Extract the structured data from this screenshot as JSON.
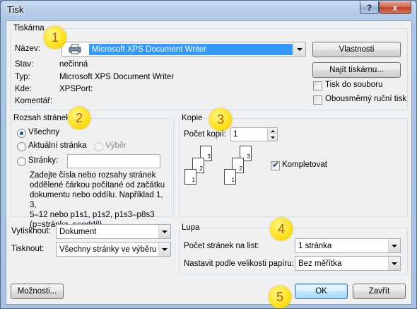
{
  "window": {
    "title": "Tisk",
    "help_label": "?",
    "close_label": "x"
  },
  "printer": {
    "group_title": "Tiskárna",
    "name_label": "Název:",
    "name_value": "Microsoft XPS Document Writer",
    "status_label": "Stav:",
    "status_value": "nečinná",
    "type_label": "Typ:",
    "type_value": "Microsoft XPS Document Writer",
    "where_label": "Kde:",
    "where_value": "XPSPort:",
    "comment_label": "Komentář:",
    "comment_value": "",
    "properties_button": "Vlastnosti",
    "find_printer_button": "Najít tiskárnu...",
    "print_to_file_label": "Tisk do souboru",
    "print_to_file_checked": false,
    "duplex_label": "Obousměrný ruční tisk",
    "duplex_checked": false
  },
  "page_range": {
    "group_title": "Rozsah stránek",
    "all_label": "Všechny",
    "current_label": "Aktuální stránka",
    "selection_label": "Výběr",
    "pages_label": "Stránky:",
    "pages_value": "",
    "selected": "all",
    "help_lines": [
      "Zadejte čísla nebo rozsahy stránek",
      "oddělené čárkou počítané od začátku",
      "dokumentu nebo oddílu. Například 1, 3,",
      "5–12 nebo p1s1, p1s2, p1s3–p8s3",
      "(p=stránka, s=oddíl)."
    ]
  },
  "copies": {
    "group_title": "Kopie",
    "count_label": "Počet kopií:",
    "count_value": "1",
    "collate_label": "Kompletovat",
    "collate_checked": true,
    "page_numbers": [
      "1",
      "2",
      "3"
    ]
  },
  "print_what": {
    "label": "Vytisknout:",
    "value": "Dokument"
  },
  "print": {
    "label": "Tisknout:",
    "value": "Všechny stránky ve výběru"
  },
  "zoom": {
    "group_title": "Lupa",
    "pages_per_sheet_label": "Počet stránek na list:",
    "pages_per_sheet_value": "1 stránka",
    "scale_label": "Nastavit podle velikosti papíru:",
    "scale_value": "Bez měřítka"
  },
  "buttons": {
    "options": "Možnosti...",
    "ok": "OK",
    "close": "Zavřít"
  },
  "callouts": [
    "1",
    "2",
    "3",
    "4",
    "5"
  ]
}
